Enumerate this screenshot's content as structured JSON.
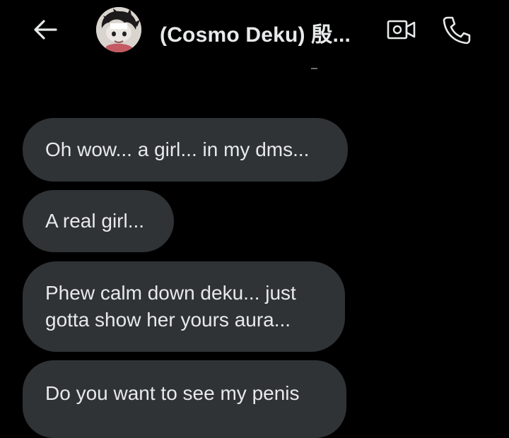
{
  "header": {
    "title": "(Cosmo Deku) 殷...",
    "back_icon": "arrow-left-icon",
    "video_icon": "video-call-icon",
    "phone_icon": "phone-icon"
  },
  "colors": {
    "background": "#000000",
    "bubble": "#2f3336",
    "text": "#e7e9ea",
    "icon": "#e7e9ea"
  },
  "messages": [
    {
      "text": "Oh wow... a girl... in my dms..."
    },
    {
      "text": "A real girl..."
    },
    {
      "lines": [
        "Phew calm down deku... just",
        "gotta show her yours aura..."
      ]
    },
    {
      "text": "Do you want to see my penis"
    }
  ]
}
